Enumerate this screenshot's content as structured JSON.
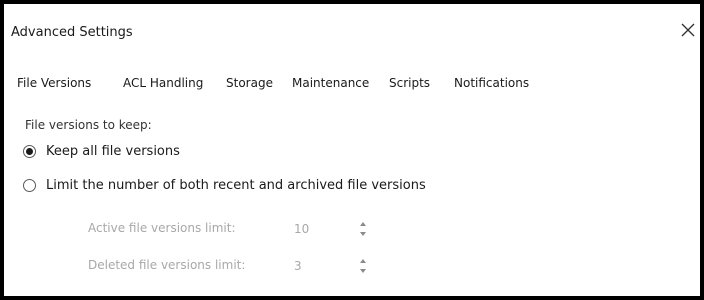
{
  "window": {
    "title": "Advanced Settings"
  },
  "tabs": [
    {
      "label": "File Versions",
      "active": true
    },
    {
      "label": "ACL Handling",
      "active": false
    },
    {
      "label": "Storage",
      "active": false
    },
    {
      "label": "Maintenance",
      "active": false
    },
    {
      "label": "Scripts",
      "active": false
    },
    {
      "label": "Notifications",
      "active": false
    }
  ],
  "file_versions": {
    "section_label": "File versions to keep:",
    "options": [
      {
        "label": "Keep all file versions",
        "checked": true
      },
      {
        "label": "Limit the number of both recent and archived file versions",
        "checked": false
      }
    ],
    "limits": {
      "active_label": "Active file versions limit:",
      "active_value": "10",
      "deleted_label": "Deleted file versions limit:",
      "deleted_value": "3",
      "enabled": false
    }
  },
  "icons": {
    "close": "close-icon",
    "stepper": "stepper-arrows-icon"
  },
  "colors": {
    "text": "#1a1a1a",
    "disabled_text": "#a8a8a8",
    "frame": "#000000"
  }
}
